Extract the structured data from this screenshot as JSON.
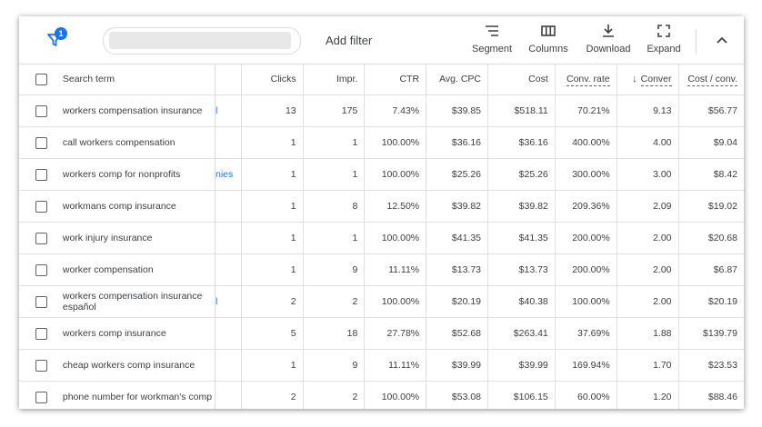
{
  "toolbar": {
    "filter_badge": "1",
    "add_filter_label": "Add filter",
    "segment_label": "Segment",
    "columns_label": "Columns",
    "download_label": "Download",
    "expand_label": "Expand",
    "accent_color": "#1a73e8"
  },
  "table": {
    "headers": {
      "term": "Search term",
      "clicks": "Clicks",
      "impr": "Impr.",
      "ctr": "CTR",
      "avg_cpc": "Avg. CPC",
      "cost": "Cost",
      "conv_rate": "Conv. rate",
      "conversions": "Conver",
      "cost_conv": "Cost / conv."
    },
    "rows": [
      {
        "term": "workers compensation insurance",
        "frag": "l",
        "clicks": "13",
        "impr": "175",
        "ctr": "7.43%",
        "avg_cpc": "$39.85",
        "cost": "$518.11",
        "conv_rate": "70.21%",
        "conversions": "9.13",
        "cost_conv": "$56.77"
      },
      {
        "term": "call workers compensation",
        "frag": "",
        "clicks": "1",
        "impr": "1",
        "ctr": "100.00%",
        "avg_cpc": "$36.16",
        "cost": "$36.16",
        "conv_rate": "400.00%",
        "conversions": "4.00",
        "cost_conv": "$9.04"
      },
      {
        "term": "workers comp for nonprofits",
        "frag": "nies",
        "clicks": "1",
        "impr": "1",
        "ctr": "100.00%",
        "avg_cpc": "$25.26",
        "cost": "$25.26",
        "conv_rate": "300.00%",
        "conversions": "3.00",
        "cost_conv": "$8.42"
      },
      {
        "term": "workmans comp insurance",
        "frag": "",
        "clicks": "1",
        "impr": "8",
        "ctr": "12.50%",
        "avg_cpc": "$39.82",
        "cost": "$39.82",
        "conv_rate": "209.36%",
        "conversions": "2.09",
        "cost_conv": "$19.02"
      },
      {
        "term": "work injury insurance",
        "frag": "",
        "clicks": "1",
        "impr": "1",
        "ctr": "100.00%",
        "avg_cpc": "$41.35",
        "cost": "$41.35",
        "conv_rate": "200.00%",
        "conversions": "2.00",
        "cost_conv": "$20.68"
      },
      {
        "term": "worker compensation",
        "frag": "",
        "clicks": "1",
        "impr": "9",
        "ctr": "11.11%",
        "avg_cpc": "$13.73",
        "cost": "$13.73",
        "conv_rate": "200.00%",
        "conversions": "2.00",
        "cost_conv": "$6.87"
      },
      {
        "term": "workers compensation insurance español",
        "frag": "l",
        "clicks": "2",
        "impr": "2",
        "ctr": "100.00%",
        "avg_cpc": "$20.19",
        "cost": "$40.38",
        "conv_rate": "100.00%",
        "conversions": "2.00",
        "cost_conv": "$20.19"
      },
      {
        "term": "workers comp insurance",
        "frag": "",
        "clicks": "5",
        "impr": "18",
        "ctr": "27.78%",
        "avg_cpc": "$52.68",
        "cost": "$263.41",
        "conv_rate": "37.69%",
        "conversions": "1.88",
        "cost_conv": "$139.79"
      },
      {
        "term": "cheap workers comp insurance",
        "frag": "",
        "clicks": "1",
        "impr": "9",
        "ctr": "11.11%",
        "avg_cpc": "$39.99",
        "cost": "$39.99",
        "conv_rate": "169.94%",
        "conversions": "1.70",
        "cost_conv": "$23.53"
      },
      {
        "term": "phone number for workman's comp",
        "frag": "",
        "clicks": "2",
        "impr": "2",
        "ctr": "100.00%",
        "avg_cpc": "$53.08",
        "cost": "$106.15",
        "conv_rate": "60.00%",
        "conversions": "1.20",
        "cost_conv": "$88.46"
      }
    ]
  }
}
